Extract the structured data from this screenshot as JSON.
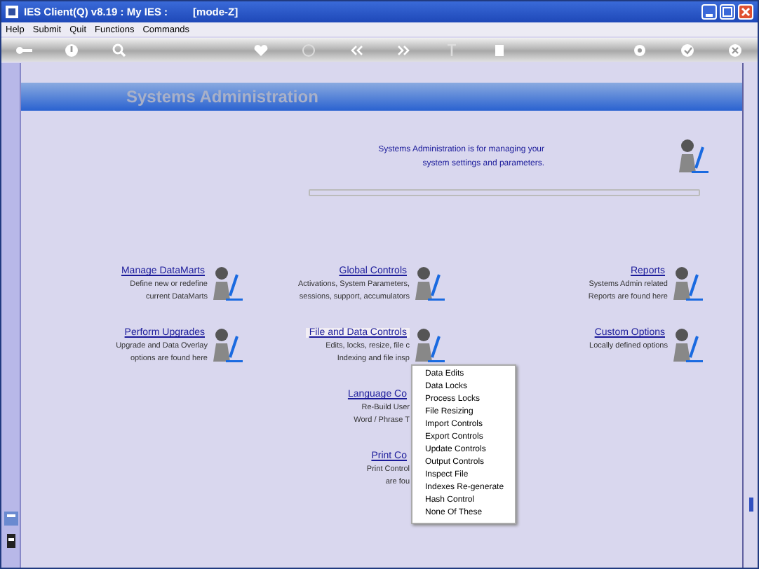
{
  "window": {
    "title": "IES Client(Q) v8.19 : My IES :",
    "mode": "[mode-Z]"
  },
  "menu_bar": [
    "Help",
    "Submit",
    "Quit",
    "Functions",
    "Commands"
  ],
  "header": {
    "title": "Systems Administration",
    "description": [
      "Systems Administration is for managing your",
      "system settings and parameters."
    ]
  },
  "columns": [
    [
      {
        "title": "Manage DataMarts",
        "lines": [
          "Define new or redefine",
          "current DataMarts"
        ],
        "selected": false,
        "icon": true
      },
      {
        "title": "Perform Upgrades",
        "lines": [
          "Upgrade and Data Overlay",
          "options are found here"
        ],
        "selected": false,
        "icon": true
      }
    ],
    [
      {
        "title": "Global Controls",
        "lines": [
          "Activations, System Parameters,",
          "sessions, support, accumulators"
        ],
        "selected": false,
        "icon": true
      },
      {
        "title": "File and Data Controls",
        "lines": [
          "Edits, locks, resize, file c",
          "Indexing and file insp"
        ],
        "selected": true,
        "icon": true
      },
      {
        "title": "Language Co",
        "lines": [
          "Re-Build User",
          "Word / Phrase T"
        ],
        "selected": false
      },
      {
        "title": "Print Co",
        "lines": [
          "Print Control",
          "are fou"
        ],
        "selected": false
      }
    ],
    [
      {
        "title": "Reports",
        "lines": [
          "Systems Admin related",
          "Reports are found here"
        ],
        "selected": false,
        "icon": true
      },
      {
        "title": "Custom Options",
        "lines": [
          "Locally defined options"
        ],
        "selected": false,
        "icon": true
      }
    ]
  ],
  "context_menu": [
    "Data Edits",
    "Data Locks",
    "Process Locks",
    "File Resizing",
    "Import Controls",
    "Export Controls",
    "Update Controls",
    "Output Controls",
    "Inspect File",
    "Indexes Re-generate",
    "Hash Control",
    "None Of These"
  ]
}
